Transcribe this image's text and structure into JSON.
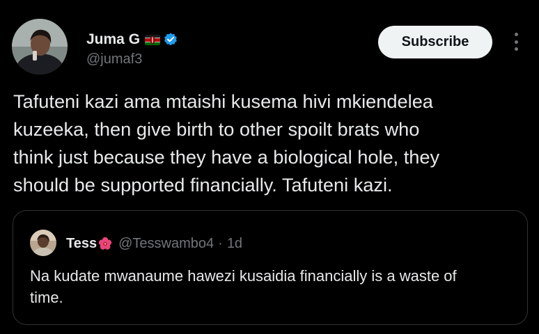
{
  "author": {
    "name": "Juma G",
    "handle": "@jumaf3",
    "flag_icon": "kenya-flag-icon",
    "verified_icon": "verified-badge-icon",
    "verified_color": "#1d9bf0"
  },
  "actions": {
    "subscribe_label": "Subscribe",
    "more_icon": "more-vertical-icon"
  },
  "tweet": {
    "text": "Tafuteni kazi ama mtaishi kusema hivi mkiendelea\nkuzeeka, then give birth to other spoilt brats who\nthink just because they have a biological hole, they\nshould be supported financially. Tafuteni kazi."
  },
  "quote": {
    "name": "Tess",
    "name_icon": "hibiscus-flower-icon",
    "handle": "@Tesswambo4",
    "separator": "·",
    "time": "1d",
    "text": "Na kudate mwanaume hawezi kusaidia financially is a waste of\ntime."
  },
  "colors": {
    "background": "#000000",
    "primary_text": "#e7e9ea",
    "secondary_text": "#71767b",
    "border": "#2f3336",
    "button_bg": "#eff3f4",
    "button_text": "#0f1419"
  }
}
